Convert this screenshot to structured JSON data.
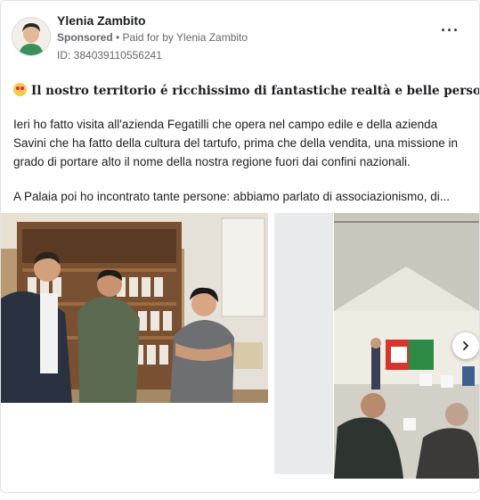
{
  "post": {
    "author": "Ylenia Zambito",
    "sponsored_label": "Sponsored",
    "paid_for_text": " • Paid for by Ylenia Zambito",
    "ad_id": "ID: 384039110556241",
    "headline": "Il nostro territorio é ricchissimo di fantastiche realtà e belle persone",
    "headline_end": ".",
    "paragraph1": "Ieri ho fatto visita all'azienda Fegatilli che opera nel campo edile e della azienda Savini che ha fatto della cultura del tartufo, prima che della vendita, una missione in grado di portare alto il nome della nostra regione fuori dai confini nazionali.",
    "paragraph2": "A Palaia poi ho incontrato tante persone: abbiamo parlato di associazionismo, di..."
  },
  "icons": {
    "more": "more-options-icon",
    "emoji": "heart-eyes-emoji-icon",
    "next": "chevron-right-icon"
  },
  "colors": {
    "text": "#1c1e21",
    "secondary_text": "#65676b",
    "border": "#e1e3e6"
  }
}
